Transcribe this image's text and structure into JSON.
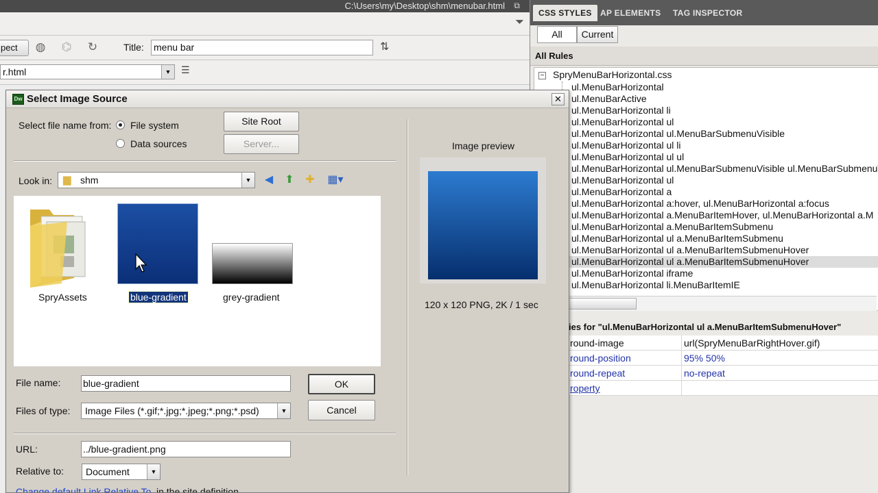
{
  "window": {
    "path": "C:\\Users\\my\\Desktop\\shm\\menubar.html"
  },
  "toolbar": {
    "inspect_label": "pect",
    "title_label": "Title:",
    "title_value": "menu bar"
  },
  "address": {
    "value": "r.html"
  },
  "panel": {
    "tabs": [
      "CSS STYLES",
      "AP ELEMENTS",
      "TAG INSPECTOR"
    ],
    "segments": [
      "All",
      "Current"
    ],
    "all_rules_label": "All Rules",
    "file": "SpryMenuBarHorizontal.css",
    "rules": [
      "ul.MenuBarHorizontal",
      "ul.MenuBarActive",
      "ul.MenuBarHorizontal li",
      "ul.MenuBarHorizontal ul",
      "ul.MenuBarHorizontal ul.MenuBarSubmenuVisible",
      "ul.MenuBarHorizontal ul li",
      "ul.MenuBarHorizontal ul ul",
      "ul.MenuBarHorizontal ul.MenuBarSubmenuVisible ul.MenuBarSubmenuV",
      "ul.MenuBarHorizontal ul",
      "ul.MenuBarHorizontal a",
      "ul.MenuBarHorizontal a:hover, ul.MenuBarHorizontal a:focus",
      "ul.MenuBarHorizontal a.MenuBarItemHover, ul.MenuBarHorizontal a.M",
      "ul.MenuBarHorizontal a.MenuBarItemSubmenu",
      "ul.MenuBarHorizontal ul a.MenuBarItemSubmenu",
      "ul.MenuBarHorizontal ul a.MenuBarItemSubmenuHover",
      "ul.MenuBarHorizontal ul a.MenuBarItemSubmenuHover",
      "ul.MenuBarHorizontal iframe",
      "ul.MenuBarHorizontal li.MenuBarItemIE"
    ],
    "selected_rule_index": 15,
    "properties_title": "ies for \"ul.MenuBarHorizontal ul a.MenuBarItemSubmenuHover\"",
    "properties": [
      {
        "key": "round-image",
        "value": "url(SpryMenuBarRightHover.gif)"
      },
      {
        "key": "round-position",
        "value": "95% 50%"
      },
      {
        "key": "round-repeat",
        "value": "no-repeat"
      },
      {
        "key": "roperty",
        "value": ""
      }
    ]
  },
  "dialog": {
    "title": "Select Image Source",
    "select_from_label": "Select file name from:",
    "radio_file_system": "File system",
    "radio_data_sources": "Data sources",
    "site_root_button": "Site Root",
    "server_button": "Server...",
    "look_in_label": "Look in:",
    "look_in_value": "shm",
    "files": [
      {
        "name": "SpryAssets",
        "kind": "folder"
      },
      {
        "name": "blue-gradient",
        "kind": "image",
        "selected": true
      },
      {
        "name": "grey-gradient",
        "kind": "image"
      }
    ],
    "file_name_label": "File name:",
    "file_name_value": "blue-gradient",
    "files_of_type_label": "Files of type:",
    "files_of_type_value": "Image Files (*.gif;*.jpg;*.jpeg;*.png;*.psd)",
    "ok_button": "OK",
    "cancel_button": "Cancel",
    "url_label": "URL:",
    "url_value": "../blue-gradient.png",
    "relative_label": "Relative to:",
    "relative_value": "Document",
    "change_link": "Change default Link Relative To",
    "change_link_suffix": "in the site definition.",
    "preview_label": "Image preview",
    "preview_info": "120 x 120 PNG, 2K / 1 sec"
  },
  "colors": {
    "selection": "#12347a",
    "link": "#1a3fcc",
    "tab_bar": "#5a5a5a"
  }
}
